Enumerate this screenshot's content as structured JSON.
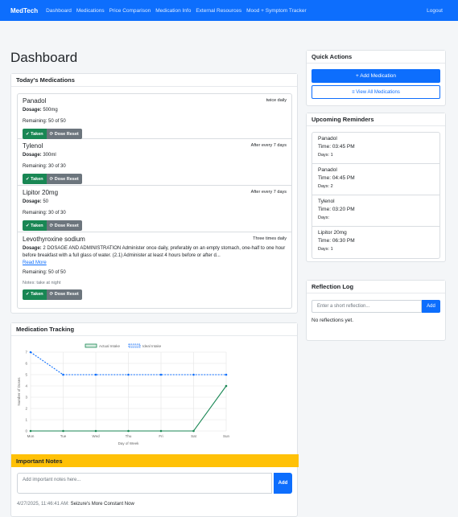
{
  "nav": {
    "brand": "MedTech",
    "links": [
      "Dashboard",
      "Medications",
      "Price Comparison",
      "Medication Info",
      "External Resources",
      "Mood + Symptom Tracker"
    ],
    "logout": "Logout"
  },
  "page_title": "Dashboard",
  "today": {
    "header": "Today's Medications",
    "taken_label": "✔ Taken",
    "reset_label": "⟳ Dose Reset",
    "dosage_label": "Dosage:",
    "medications": [
      {
        "name": "Panadol",
        "frequency": "twice daily",
        "dosage": "500mg",
        "remaining": "Remaining: 50 of 50"
      },
      {
        "name": "Tylenol",
        "frequency": "After every 7 days",
        "dosage": "300ml",
        "remaining": "Remaining: 30 of 30"
      },
      {
        "name": "Lipitor 20mg",
        "frequency": "After every 7 days",
        "dosage": "50",
        "remaining": "Remaining: 30 of 30"
      },
      {
        "name": "Levothyroxine sodium",
        "frequency": "Three times daily",
        "dosage": "2 DOSAGE AND ADMINISTRATION Administer once daily, preferably on an empty stomach, one-half to one hour before breakfast with a full glass of water. (2.1) Administer at least 4 hours before or after d...",
        "read_more": "Read More",
        "remaining": "Remaining: 50 of 50",
        "notes": "Notes: take at night"
      }
    ]
  },
  "tracking": {
    "header": "Medication Tracking"
  },
  "chart_data": {
    "type": "line",
    "categories": [
      "Mon",
      "Tue",
      "Wed",
      "Thu",
      "Fri",
      "Sat",
      "Sun"
    ],
    "series": [
      {
        "name": "Actual Intake",
        "values": [
          0,
          0,
          0,
          0,
          0,
          0,
          4
        ],
        "color": "#198754",
        "style": "solid"
      },
      {
        "name": "Ideal Intake",
        "values": [
          7,
          5,
          5,
          5,
          5,
          5,
          5
        ],
        "color": "#0d6efd",
        "style": "dashed"
      }
    ],
    "ylim": [
      0,
      7
    ],
    "yticks": [
      0,
      1,
      2,
      3,
      4,
      5,
      6,
      7
    ],
    "xlabel": "Day of Week",
    "ylabel": "Number of Doses",
    "legend": "top-center",
    "grid": true
  },
  "notes": {
    "header": "Important Notes",
    "placeholder": "Add important notes here...",
    "add_label": "Add",
    "entries": [
      {
        "timestamp": "4/27/2025, 11:46:41 AM:",
        "text": "Seizure's More Constant Now"
      }
    ]
  },
  "quick_actions": {
    "header": "Quick Actions",
    "add_label": "+ Add Medication",
    "view_label": "≡ View All Medications"
  },
  "reminders": {
    "header": "Upcoming Reminders",
    "items": [
      {
        "name": "Panadol",
        "time": "Time: 03:45 PM",
        "days": "Days: 1"
      },
      {
        "name": "Panadol",
        "time": "Time: 04:45 PM",
        "days": "Days: 2"
      },
      {
        "name": "Tylenol",
        "time": "Time: 03:20 PM",
        "days": "Days:"
      },
      {
        "name": "Lipitor 20mg",
        "time": "Time: 06:30 PM",
        "days": "Days: 1"
      }
    ]
  },
  "reflection": {
    "header": "Reflection Log",
    "placeholder": "Enter a short reflection...",
    "add_label": "Add",
    "empty": "No reflections yet."
  }
}
